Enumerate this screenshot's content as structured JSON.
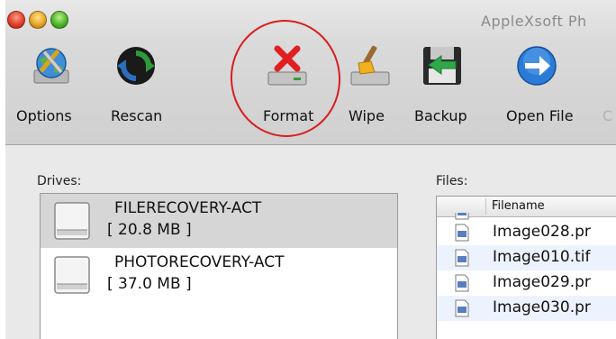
{
  "window": {
    "title": "AppleXsoft Ph"
  },
  "toolbar": {
    "buttons": [
      {
        "label": "Options",
        "icon": "globe-tools-icon"
      },
      {
        "label": "Rescan",
        "icon": "rescan-icon"
      },
      {
        "label": "Format",
        "icon": "format-drive-icon"
      },
      {
        "label": "Wipe",
        "icon": "wipe-drive-icon"
      },
      {
        "label": "Backup",
        "icon": "floppy-backup-icon"
      },
      {
        "label": "Open File",
        "icon": "open-file-icon"
      },
      {
        "label": "C",
        "icon": ""
      }
    ],
    "highlighted": "Format",
    "highlight_color": "#d81e1e"
  },
  "drives": {
    "label": "Drives:",
    "items": [
      {
        "name": "FILERECOVERY-ACT",
        "size": "[ 20.8 MB ]",
        "selected": true
      },
      {
        "name": "PHOTORECOVERY-ACT",
        "size": "[ 37.0 MB ]",
        "selected": false
      }
    ]
  },
  "files": {
    "label": "Files:",
    "column_header": "Filename",
    "rows": [
      {
        "name": ""
      },
      {
        "name": "Image028.pr"
      },
      {
        "name": "Image010.tif"
      },
      {
        "name": "Image029.pr"
      },
      {
        "name": "Image030.pr"
      }
    ]
  },
  "colors": {
    "selection_row": "#d6d6d6",
    "alt_row": "#edf3fe"
  }
}
